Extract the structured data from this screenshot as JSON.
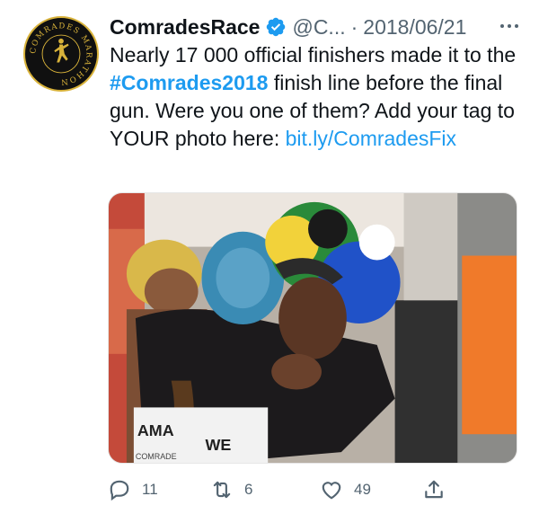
{
  "tweet": {
    "display_name": "ComradesRace",
    "handle": "@C...",
    "separator": "·",
    "date": "2018/06/21",
    "text_parts": {
      "before_hashtag": "Nearly 17 000 official finishers made it to the ",
      "hashtag": "#Comrades2018",
      "after_hashtag": " finish line before the final gun. Were you one of them? Add your tag to YOUR photo here: ",
      "link": "bit.ly/ComradesFix"
    },
    "photo": {
      "bib_text_1": "AMA",
      "bib_text_2": "WE",
      "bib_text_3": "COMRADE"
    },
    "avatar": {
      "logo_text": "COMRADES MARATHON"
    },
    "actions": {
      "replies": "11",
      "retweets": "6",
      "likes": "49"
    },
    "icons": {
      "verified": "verified-badge-icon",
      "more": "more-options-icon",
      "reply": "reply-icon",
      "retweet": "retweet-icon",
      "like": "heart-icon",
      "share": "share-icon"
    },
    "colors": {
      "link": "#1d9bf0",
      "muted": "#536471",
      "text": "#0f1419"
    }
  }
}
